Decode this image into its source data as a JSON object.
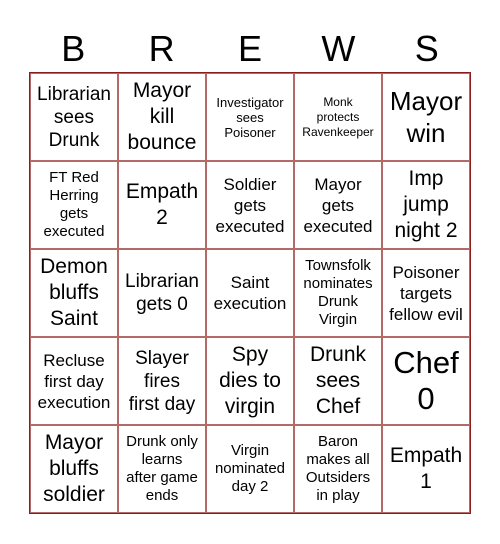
{
  "header": {
    "letters": [
      "B",
      "R",
      "E",
      "W",
      "S"
    ]
  },
  "board": {
    "border_color": "#8b1c1c",
    "cells": [
      "Librarian\nsees\nDrunk",
      "Mayor\nkill\nbounce",
      "Investigator\nsees\nPoisoner",
      "Monk\nprotects\nRavenkeeper",
      "Mayor\nwin",
      "FT Red\nHerring\ngets\nexecuted",
      "Empath\n2",
      "Soldier\ngets\nexecuted",
      "Mayor\ngets\nexecuted",
      "Imp\njump\nnight 2",
      "Demon\nbluffs\nSaint",
      "Librarian\ngets 0",
      "Saint\nexecution",
      "Townsfolk\nnominates\nDrunk\nVirgin",
      "Poisoner\ntargets\nfellow evil",
      "Recluse\nfirst day\nexecution",
      "Slayer\nfires\nfirst day",
      "Spy\ndies to\nvirgin",
      "Drunk\nsees\nChef",
      "Chef\n0",
      "Mayor\nbluffs\nsoldier",
      "Drunk only\nlearns\nafter game\nends",
      "Virgin\nnominated\nday 2",
      "Baron\nmakes all\nOutsiders\nin play",
      "Empath\n1"
    ]
  }
}
